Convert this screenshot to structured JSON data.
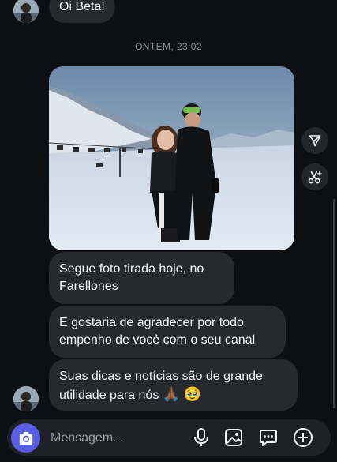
{
  "messages": {
    "top_message": "Oi Beta!",
    "timestamp": "ONTEM, 23:02",
    "msg1_line1": "Segue foto tirada hoje, no",
    "msg1_line2": "Farellones",
    "msg2_line1": "E gostaria de agradecer por todo",
    "msg2_line2": "empenho de você com o seu canal",
    "msg3_line1": "Suas dicas e notícias são de grande",
    "msg3_line2": "utilidade para nós",
    "msg3_emoji1": "🙏🏾",
    "msg3_emoji2": "🥹"
  },
  "side_actions": {
    "share_icon": "send-icon",
    "edit_icon": "scissors-sparkle-icon"
  },
  "composer": {
    "placeholder": "Mensagem...",
    "icons": [
      "camera-icon",
      "microphone-icon",
      "gallery-icon",
      "sticker-icon",
      "add-icon"
    ],
    "accent_color": "#5a5de6"
  },
  "colors": {
    "background": "#0c1014",
    "bubble": "#262a2f"
  }
}
